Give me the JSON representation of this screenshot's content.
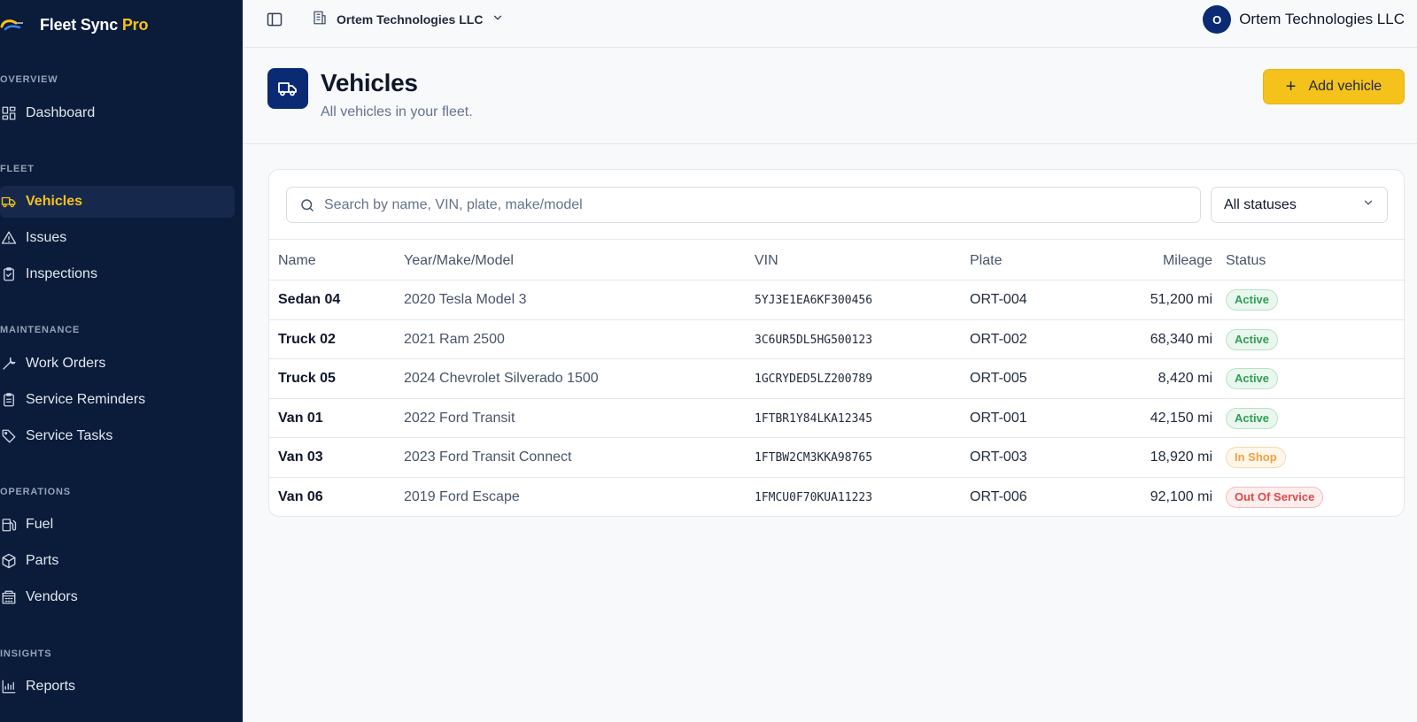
{
  "brand": {
    "name": "Fleet Sync",
    "suffix": "Pro"
  },
  "sidebar": {
    "sections": [
      {
        "title": "OVERVIEW",
        "items": [
          {
            "label": "Dashboard",
            "icon": "dashboard-icon"
          }
        ]
      },
      {
        "title": "FLEET",
        "items": [
          {
            "label": "Vehicles",
            "icon": "truck-icon",
            "active": true
          },
          {
            "label": "Issues",
            "icon": "warning-icon"
          },
          {
            "label": "Inspections",
            "icon": "clipboard-check-icon"
          }
        ]
      },
      {
        "title": "MAINTENANCE",
        "items": [
          {
            "label": "Work Orders",
            "icon": "wrench-icon"
          },
          {
            "label": "Service Reminders",
            "icon": "clipboard-list-icon"
          },
          {
            "label": "Service Tasks",
            "icon": "tag-icon"
          }
        ]
      },
      {
        "title": "OPERATIONS",
        "items": [
          {
            "label": "Fuel",
            "icon": "fuel-icon"
          },
          {
            "label": "Parts",
            "icon": "package-icon"
          },
          {
            "label": "Vendors",
            "icon": "building-icon"
          }
        ]
      },
      {
        "title": "INSIGHTS",
        "items": [
          {
            "label": "Reports",
            "icon": "bar-chart-icon"
          }
        ]
      }
    ]
  },
  "topbar": {
    "org_name": "Ortem Technologies LLC",
    "user_initial": "O",
    "user_name": "Ortem Technologies LLC"
  },
  "page": {
    "title": "Vehicles",
    "subtitle": "All vehicles in your fleet.",
    "add_button": "Add vehicle"
  },
  "filters": {
    "search_placeholder": "Search by name, VIN, plate, make/model",
    "status_selected": "All statuses"
  },
  "table": {
    "headers": {
      "name": "Name",
      "ymm": "Year/Make/Model",
      "vin": "VIN",
      "plate": "Plate",
      "mileage": "Mileage",
      "status": "Status"
    },
    "rows": [
      {
        "name": "Sedan 04",
        "ymm": "2020 Tesla Model 3",
        "vin": "5YJ3E1EA6KF300456",
        "plate": "ORT-004",
        "mileage": "51,200 mi",
        "status": "Active",
        "status_kind": "active"
      },
      {
        "name": "Truck 02",
        "ymm": "2021 Ram 2500",
        "vin": "3C6UR5DL5HG500123",
        "plate": "ORT-002",
        "mileage": "68,340 mi",
        "status": "Active",
        "status_kind": "active"
      },
      {
        "name": "Truck 05",
        "ymm": "2024 Chevrolet Silverado 1500",
        "vin": "1GCRYDED5LZ200789",
        "plate": "ORT-005",
        "mileage": "8,420 mi",
        "status": "Active",
        "status_kind": "active"
      },
      {
        "name": "Van 01",
        "ymm": "2022 Ford Transit",
        "vin": "1FTBR1Y84LKA12345",
        "plate": "ORT-001",
        "mileage": "42,150 mi",
        "status": "Active",
        "status_kind": "active"
      },
      {
        "name": "Van 03",
        "ymm": "2023 Ford Transit Connect",
        "vin": "1FTBW2CM3KKA98765",
        "plate": "ORT-003",
        "mileage": "18,920 mi",
        "status": "In Shop",
        "status_kind": "shop"
      },
      {
        "name": "Van 06",
        "ymm": "2019 Ford Escape",
        "vin": "1FMCU0F70KUA11223",
        "plate": "ORT-006",
        "mileage": "92,100 mi",
        "status": "Out Of Service",
        "status_kind": "oos"
      }
    ]
  },
  "colors": {
    "sidebar_bg": "#0b1b3a",
    "accent": "#f5c21b",
    "primary": "#0b2a74",
    "active_green": "#2f9e55",
    "shop_orange": "#f0a040",
    "oos_red": "#e04848"
  }
}
